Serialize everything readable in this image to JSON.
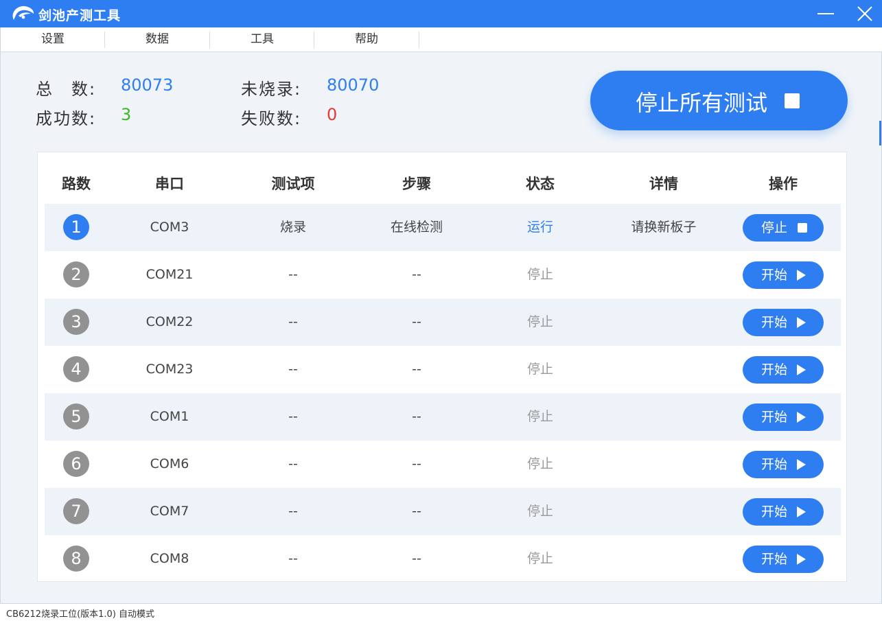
{
  "window": {
    "title": "剑池产测工具"
  },
  "menu": [
    {
      "label": "设置"
    },
    {
      "label": "数据"
    },
    {
      "label": "工具"
    },
    {
      "label": "帮助"
    }
  ],
  "stats": {
    "total": {
      "label": "总　数:",
      "value": "80073",
      "color": "#2e7ef2"
    },
    "unburned": {
      "label": "未烧录:",
      "value": "80070",
      "color": "#2e7ef2"
    },
    "success": {
      "label": "成功数:",
      "value": "3",
      "color": "#3cb62b"
    },
    "fail": {
      "label": "失败数:",
      "value": "0",
      "color": "#e53935"
    }
  },
  "stop_all_button": {
    "label": "停止所有测试",
    "icon": "stop-icon"
  },
  "table": {
    "headers": [
      "路数",
      "串口",
      "测试项",
      "步骤",
      "状态",
      "详情",
      "操作"
    ],
    "rows": [
      {
        "index": "1",
        "port": "COM3",
        "item": "烧录",
        "step": "在线检测",
        "status": "运行",
        "detail": "请换新板子",
        "action": "停止",
        "active": true
      },
      {
        "index": "2",
        "port": "COM21",
        "item": "--",
        "step": "--",
        "status": "停止",
        "detail": "",
        "action": "开始",
        "active": false
      },
      {
        "index": "3",
        "port": "COM22",
        "item": "--",
        "step": "--",
        "status": "停止",
        "detail": "",
        "action": "开始",
        "active": false
      },
      {
        "index": "4",
        "port": "COM23",
        "item": "--",
        "step": "--",
        "status": "停止",
        "detail": "",
        "action": "开始",
        "active": false
      },
      {
        "index": "5",
        "port": "COM1",
        "item": "--",
        "step": "--",
        "status": "停止",
        "detail": "",
        "action": "开始",
        "active": false
      },
      {
        "index": "6",
        "port": "COM6",
        "item": "--",
        "step": "--",
        "status": "停止",
        "detail": "",
        "action": "开始",
        "active": false
      },
      {
        "index": "7",
        "port": "COM7",
        "item": "--",
        "step": "--",
        "status": "停止",
        "detail": "",
        "action": "开始",
        "active": false
      },
      {
        "index": "8",
        "port": "COM8",
        "item": "--",
        "step": "--",
        "status": "停止",
        "detail": "",
        "action": "开始",
        "active": false
      }
    ]
  },
  "statusbar": {
    "text": "CB6212烧录工位(版本1.0) 自动模式"
  },
  "colors": {
    "accent": "#2e7ef2",
    "running": "#2e7ef2",
    "stopped": "#9a9a9a",
    "success": "#3cb62b",
    "fail": "#e53935"
  }
}
